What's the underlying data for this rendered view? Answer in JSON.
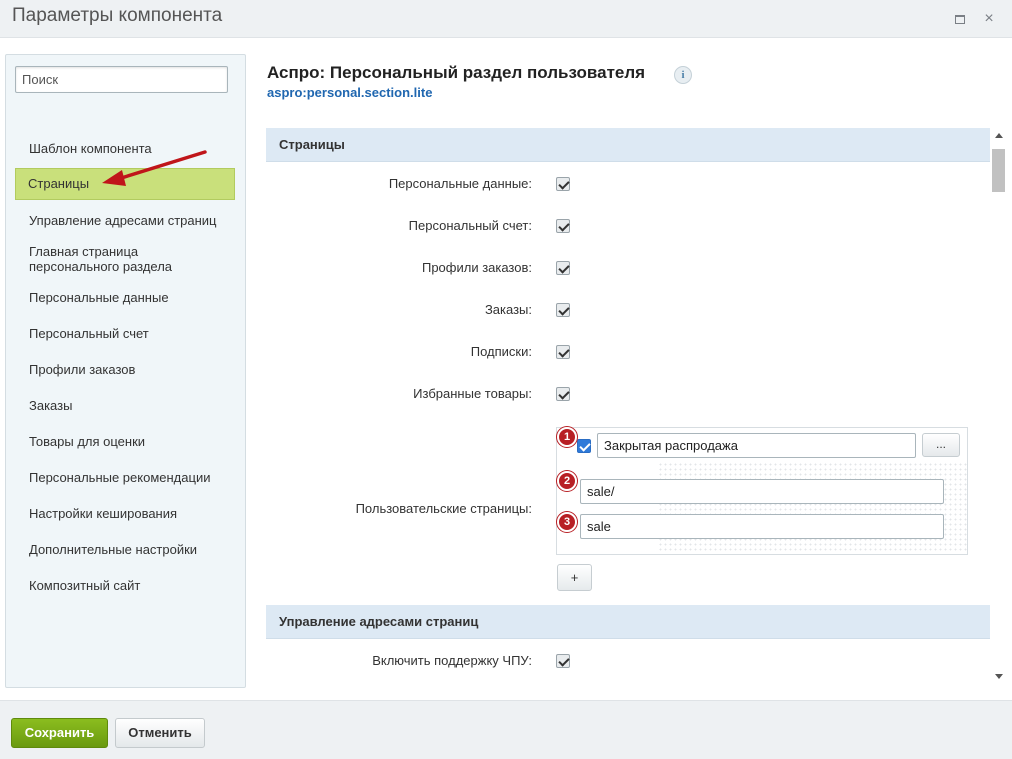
{
  "window": {
    "title": "Параметры компонента",
    "maximize_icon": "maximize-icon",
    "close_icon": "close-icon",
    "close_glyph": "×"
  },
  "sidebar": {
    "search_placeholder": "Поиск",
    "items": [
      {
        "label": "Шаблон компонента",
        "active": false
      },
      {
        "label": "Страницы",
        "active": true
      },
      {
        "label": "Управление адресами страниц",
        "active": false
      },
      {
        "label": "Главная страница персонального раздела",
        "active": false
      },
      {
        "label": "Персональные данные",
        "active": false
      },
      {
        "label": "Персональный счет",
        "active": false
      },
      {
        "label": "Профили заказов",
        "active": false
      },
      {
        "label": "Заказы",
        "active": false
      },
      {
        "label": "Товары для оценки",
        "active": false
      },
      {
        "label": "Персональные рекомендации",
        "active": false
      },
      {
        "label": "Настройки кеширования",
        "active": false
      },
      {
        "label": "Дополнительные настройки",
        "active": false
      },
      {
        "label": "Композитный сайт",
        "active": false
      }
    ]
  },
  "header": {
    "title": "Аспро: Персональный раздел пользователя",
    "code": "aspro:personal.section.lite",
    "info_glyph": "i"
  },
  "sections": {
    "pages": {
      "title": "Страницы",
      "rows": [
        {
          "label": "Персональные данные:",
          "checked": true
        },
        {
          "label": "Персональный счет:",
          "checked": true
        },
        {
          "label": "Профили заказов:",
          "checked": true
        },
        {
          "label": "Заказы:",
          "checked": true
        },
        {
          "label": "Подписки:",
          "checked": true
        },
        {
          "label": "Избранные товары:",
          "checked": true
        }
      ],
      "custom_pages": {
        "label": "Пользовательские страницы:",
        "name_value": "Закрытая распродажа",
        "browse_label": "...",
        "url_value": "sale/",
        "code_value": "sale",
        "add_label": "+",
        "badges": [
          "1",
          "2",
          "3"
        ]
      }
    },
    "urls": {
      "title": "Управление адресами страниц",
      "rows": [
        {
          "label": "Включить поддержку ЧПУ:",
          "checked": true
        }
      ]
    }
  },
  "footer": {
    "save_label": "Сохранить",
    "cancel_label": "Отменить"
  },
  "colors": {
    "active_item": "#c9e07b",
    "section_header": "#dde9f4",
    "save_button": "#7aab17",
    "badge": "#b81f24",
    "arrow": "#c0151a",
    "link": "#2067b0"
  }
}
